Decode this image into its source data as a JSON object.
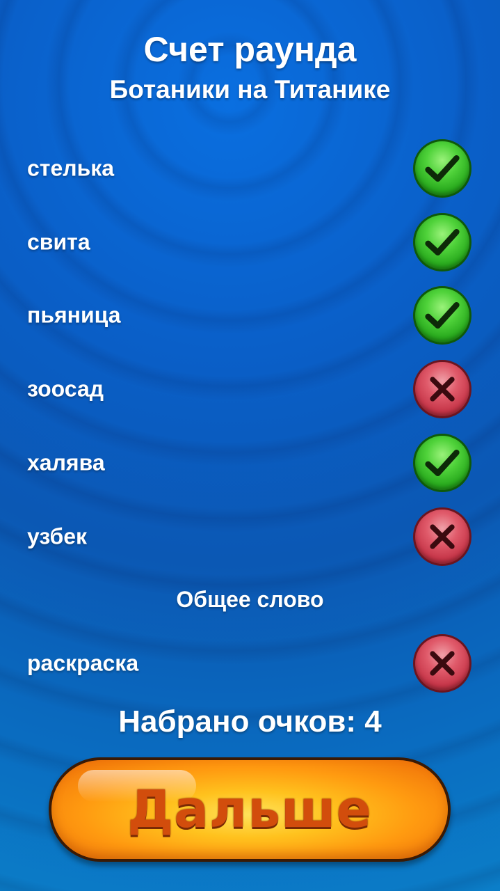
{
  "header": {
    "title": "Счет раунда",
    "subtitle": "Ботаники на Титанике"
  },
  "words": [
    {
      "word": "стелька",
      "result": "correct",
      "icon": "check-icon"
    },
    {
      "word": "свита",
      "result": "correct",
      "icon": "check-icon"
    },
    {
      "word": "пьяница",
      "result": "correct",
      "icon": "check-icon"
    },
    {
      "word": "зоосад",
      "result": "wrong",
      "icon": "cross-icon"
    },
    {
      "word": "халява",
      "result": "correct",
      "icon": "check-icon"
    },
    {
      "word": "узбек",
      "result": "wrong",
      "icon": "cross-icon"
    }
  ],
  "common_section": {
    "label": "Общее слово",
    "word": "раскраска",
    "result": "wrong",
    "icon": "cross-icon"
  },
  "score_text": "Набрано очков: 4",
  "next_button": {
    "label": "Дальше"
  },
  "colors": {
    "correct": "#27a81c",
    "wrong": "#c53447",
    "button": "#ff9a10"
  }
}
